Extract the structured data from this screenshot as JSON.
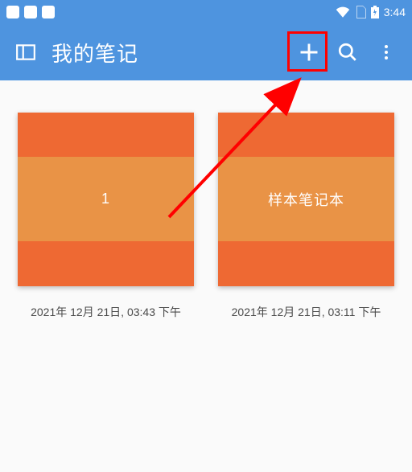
{
  "status": {
    "time": "3:44"
  },
  "appbar": {
    "title": "我的笔记"
  },
  "notebooks": [
    {
      "title": "1",
      "date": "2021年 12月 21日, 03:43 下午"
    },
    {
      "title": "样本笔记本",
      "date": "2021年 12月 21日, 03:11 下午"
    }
  ]
}
